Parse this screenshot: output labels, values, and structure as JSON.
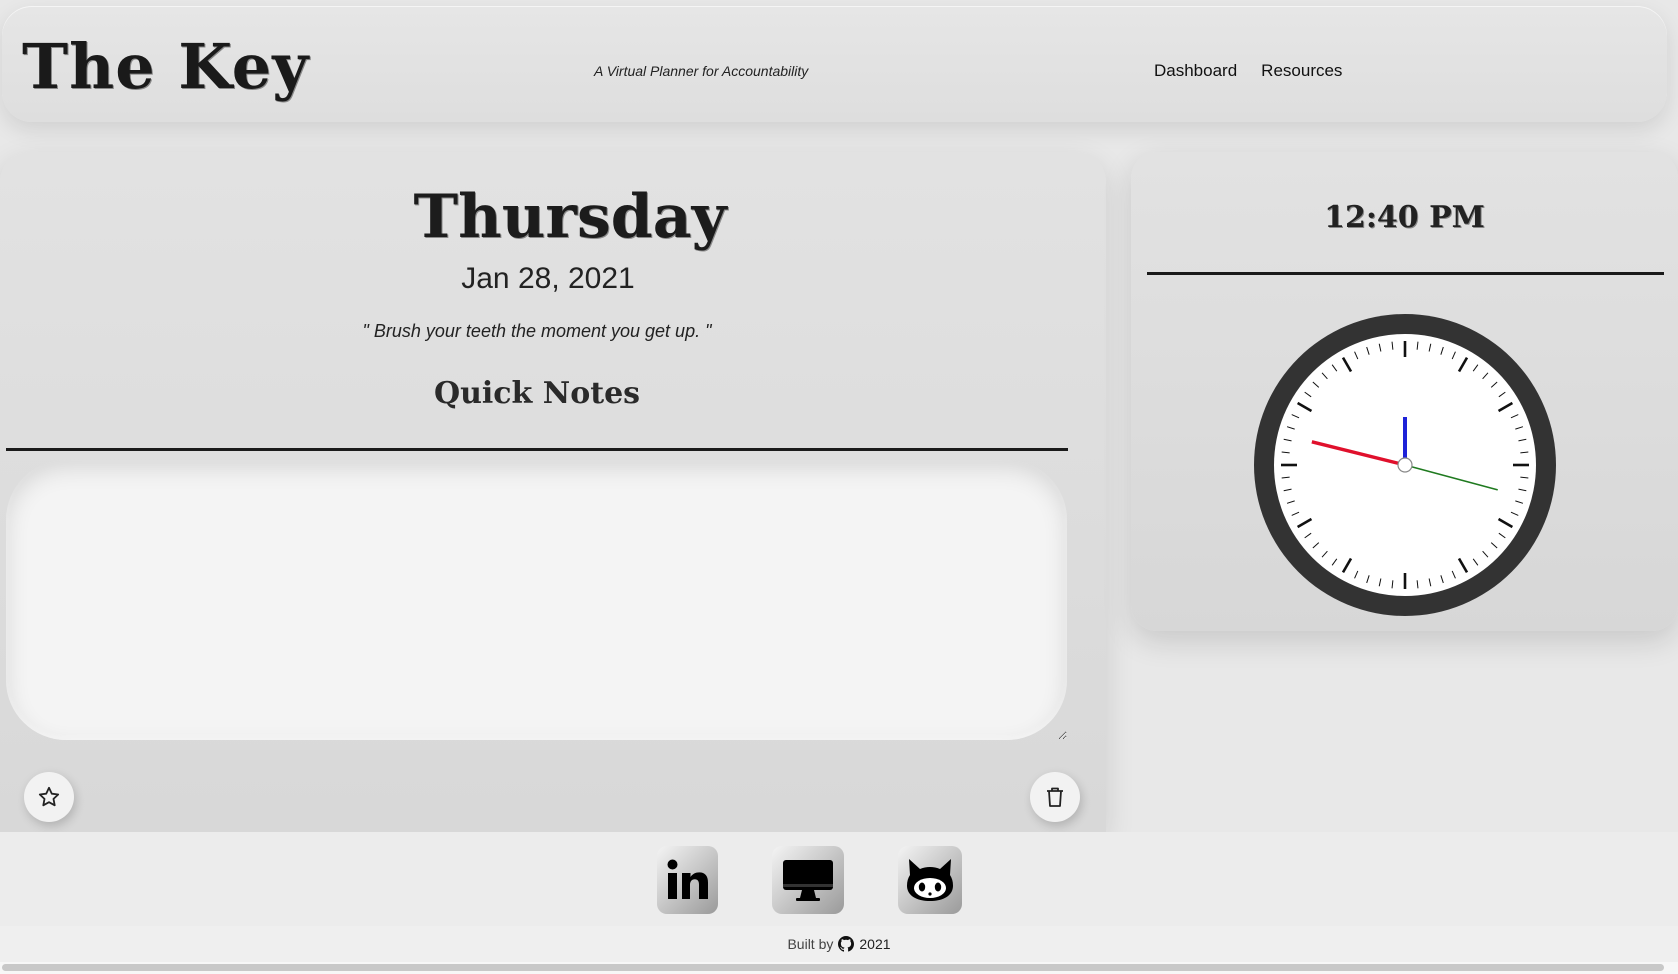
{
  "header": {
    "brand": "The Key",
    "tagline": "A Virtual Planner for Accountability",
    "nav": [
      "Dashboard",
      "Resources"
    ]
  },
  "main": {
    "day": "Thursday",
    "date": "Jan 28, 2021",
    "quote": "\" Brush your teeth the moment you get up. \"",
    "notes_heading": "Quick Notes",
    "notes_value": "",
    "star_icon": "star-icon",
    "trash_icon": "trash-icon"
  },
  "clock": {
    "time": "12:40 PM",
    "hours": 12,
    "minutes": 40,
    "seconds": 20,
    "colors": {
      "hour_hand": "#1e22d8",
      "minute_hand": "#e0102c",
      "second_hand": "#1f7a1f",
      "rim": "#333333",
      "face": "#ffffff"
    }
  },
  "footer": {
    "social": [
      "linkedin-icon",
      "desktop-icon",
      "github-icon"
    ],
    "credit_prefix": "Built by",
    "credit_year": "2021"
  }
}
